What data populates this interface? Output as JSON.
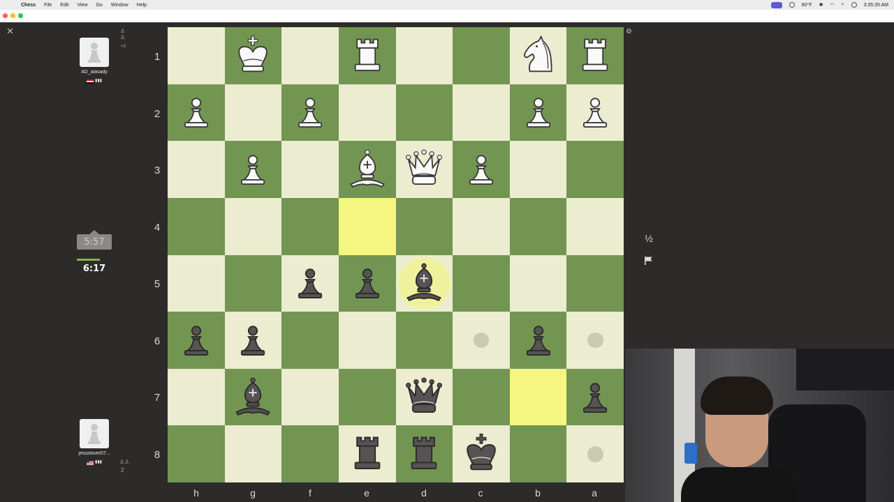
{
  "menubar": {
    "app_name": "Chess",
    "items": [
      "File",
      "Edit",
      "View",
      "Go",
      "Window",
      "Help"
    ],
    "weather": "80°F",
    "time": "3:35:35 AM"
  },
  "players": {
    "top": {
      "name": "AD_alasady",
      "flag": "EG",
      "side_label": "+3"
    },
    "bottom": {
      "name": "jesuslover07...",
      "flag": "US",
      "side_label": "2"
    }
  },
  "clocks": {
    "opponent": "5:57",
    "self": "6:17",
    "self_remaining_fraction": 0.65
  },
  "controls": {
    "draw_label": "½"
  },
  "board": {
    "ranks": [
      "1",
      "2",
      "3",
      "4",
      "5",
      "6",
      "7",
      "8"
    ],
    "files": [
      "h",
      "g",
      "f",
      "e",
      "d",
      "c",
      "b",
      "a"
    ],
    "pieces": [
      {
        "square": "g1",
        "piece": "king",
        "color": "white"
      },
      {
        "square": "e1",
        "piece": "rook",
        "color": "white"
      },
      {
        "square": "b1",
        "piece": "knight",
        "color": "white"
      },
      {
        "square": "a1",
        "piece": "rook",
        "color": "white"
      },
      {
        "square": "h2",
        "piece": "pawn",
        "color": "white"
      },
      {
        "square": "f2",
        "piece": "pawn",
        "color": "white"
      },
      {
        "square": "b2",
        "piece": "pawn",
        "color": "white"
      },
      {
        "square": "a2",
        "piece": "pawn",
        "color": "white"
      },
      {
        "square": "g3",
        "piece": "pawn",
        "color": "white"
      },
      {
        "square": "e3",
        "piece": "bishop",
        "color": "white"
      },
      {
        "square": "d3",
        "piece": "queen",
        "color": "white"
      },
      {
        "square": "c3",
        "piece": "pawn",
        "color": "white"
      },
      {
        "square": "f5",
        "piece": "pawn",
        "color": "black"
      },
      {
        "square": "e5",
        "piece": "pawn",
        "color": "black"
      },
      {
        "square": "d5",
        "piece": "bishop",
        "color": "black"
      },
      {
        "square": "h6",
        "piece": "pawn",
        "color": "black"
      },
      {
        "square": "g6",
        "piece": "pawn",
        "color": "black"
      },
      {
        "square": "b6",
        "piece": "pawn",
        "color": "black"
      },
      {
        "square": "g7",
        "piece": "bishop",
        "color": "black"
      },
      {
        "square": "d7",
        "piece": "queen",
        "color": "black"
      },
      {
        "square": "a7",
        "piece": "pawn",
        "color": "black"
      },
      {
        "square": "e8",
        "piece": "rook",
        "color": "black"
      },
      {
        "square": "d8",
        "piece": "rook",
        "color": "black"
      },
      {
        "square": "c8",
        "piece": "king",
        "color": "black"
      }
    ],
    "last_move_squares": [
      "e4",
      "b7"
    ],
    "selected_square": "d5",
    "move_hints": [
      "c6",
      "a6",
      "a8"
    ],
    "colors": {
      "light": "#ebecd0",
      "dark": "#739552",
      "highlight": "#f5f682"
    }
  }
}
